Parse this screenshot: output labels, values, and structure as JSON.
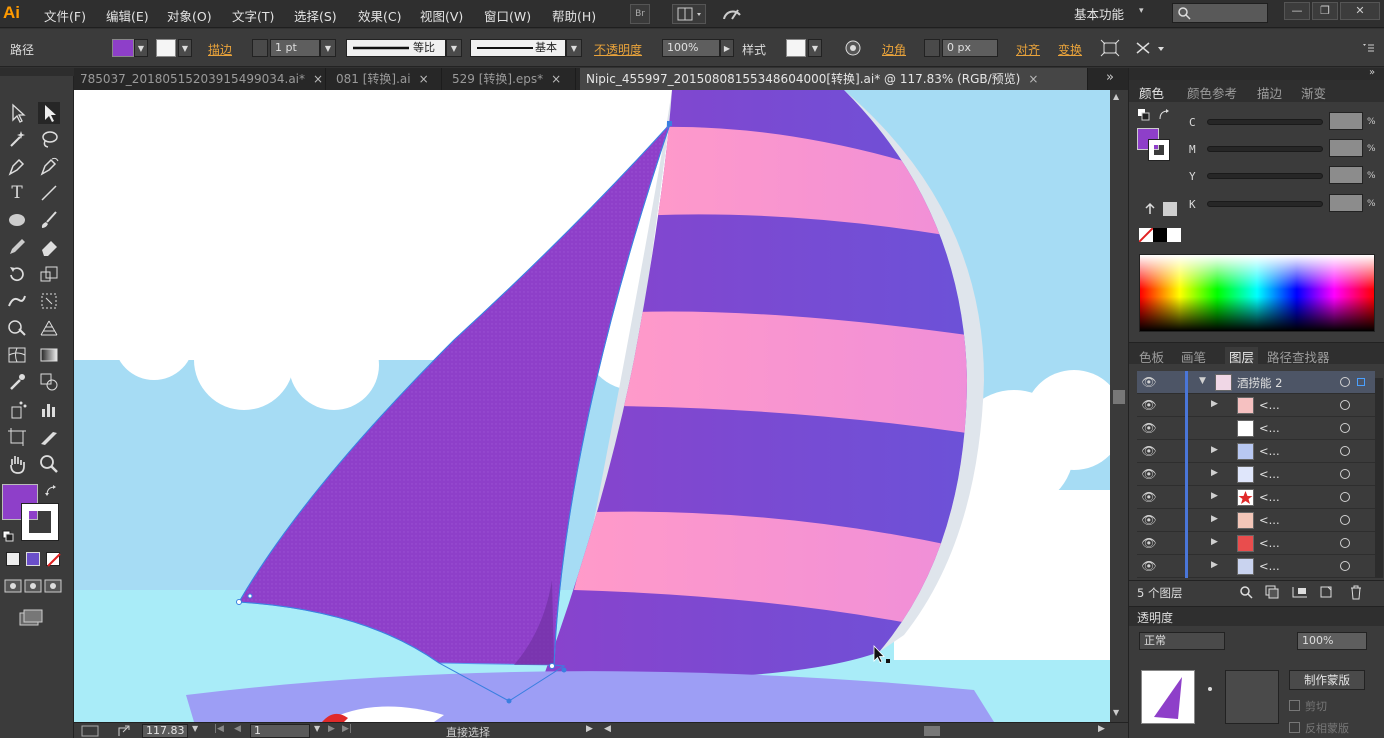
{
  "app": {
    "logo": "Ai"
  },
  "menu": [
    "文件(F)",
    "编辑(E)",
    "对象(O)",
    "文字(T)",
    "选择(S)",
    "效果(C)",
    "视图(V)",
    "窗口(W)",
    "帮助(H)"
  ],
  "menubar_extra": {
    "bridge_label": "Br",
    "workspace": "基本功能",
    "workspace_arrow": "▾",
    "win_min": "—",
    "win_restore": "❐",
    "win_close": "✕"
  },
  "control": {
    "object_type": "路径",
    "stroke_link": "描边",
    "stroke_weight": "1 pt",
    "profile_uniform": "等比",
    "brush_basic": "基本",
    "opacity_link": "不透明度",
    "opacity_value": "100%",
    "style_label": "样式",
    "corner_link": "边角",
    "corner_value": "0 px",
    "align_link": "对齐",
    "transform_link": "变换",
    "fill_color": "#8e3fc9"
  },
  "tabs": [
    {
      "label": "785037_20180515203915499034.ai*",
      "active": false
    },
    {
      "label": "081 [转换].ai",
      "active": false
    },
    {
      "label": "529 [转换].eps*",
      "active": false
    },
    {
      "label": "Nipic_455997_20150808155348604000[转换].ai* @ 117.83% (RGB/预览)",
      "active": true
    }
  ],
  "tabs_overflow": "»",
  "status": {
    "zoom": "117.83",
    "artboard": "1",
    "tool_name": "直接选择"
  },
  "color_panel": {
    "tabs": [
      "颜色",
      "颜色参考",
      "描边",
      "渐变"
    ],
    "channels": [
      "C",
      "M",
      "Y",
      "K"
    ],
    "percent": "%"
  },
  "layers_panel": {
    "tabs": [
      "色板",
      "画笔",
      "图层",
      "路径查找器"
    ],
    "top_layer": "酒捞能 2",
    "sublayer_label": "<...",
    "sublayer_count": 8,
    "footer": "5 个图层"
  },
  "transparency_panel": {
    "title": "透明度",
    "blend_mode": "正常",
    "opacity": "100%",
    "make_mask": "制作蒙版",
    "clip": "剪切",
    "invert": "反相蒙版"
  },
  "colors": {
    "sky": "#a6dcf4",
    "cloud": "#ffffff",
    "sail_left": "#8e3fc9",
    "sail_right_purple": "#7b46d3",
    "sail_right_pink": "#f59bd0",
    "hull": "#9d9ef5",
    "accent_orange": "#e9a33b"
  }
}
